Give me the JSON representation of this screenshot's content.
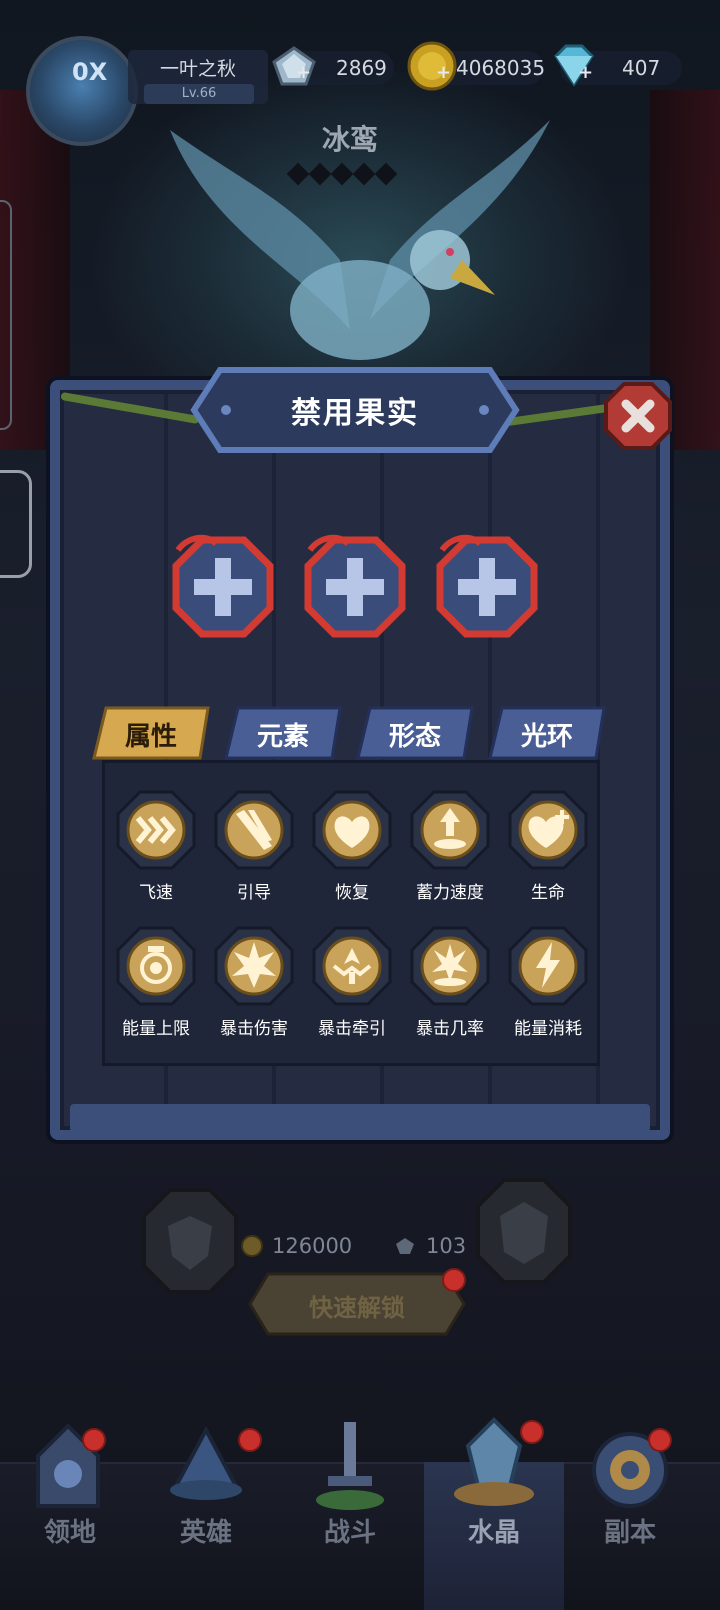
{
  "player": {
    "name": "一叶之秋",
    "level": "Lv.66",
    "avatar_mark": "0X"
  },
  "resources": {
    "crystal": "2869",
    "gold": "4068035",
    "gem": "407"
  },
  "hero": {
    "name": "冰鸾"
  },
  "dialog": {
    "title": "禁用果实"
  },
  "tabs": [
    {
      "label": "属性"
    },
    {
      "label": "元素"
    },
    {
      "label": "形态"
    },
    {
      "label": "光环"
    }
  ],
  "skills": [
    {
      "label": "飞速",
      "icon": "chevron-speed-icon"
    },
    {
      "label": "引导",
      "icon": "beam-icon"
    },
    {
      "label": "恢复",
      "icon": "heart-shield-icon"
    },
    {
      "label": "蓄力速度",
      "icon": "charge-up-icon"
    },
    {
      "label": "生命",
      "icon": "heart-plus-icon"
    },
    {
      "label": "能量上限",
      "icon": "energy-swirl-icon"
    },
    {
      "label": "暴击伤害",
      "icon": "burst-icon"
    },
    {
      "label": "暴击牵引",
      "icon": "crit-pull-icon"
    },
    {
      "label": "暴击几率",
      "icon": "crit-chance-icon"
    },
    {
      "label": "能量消耗",
      "icon": "lightning-icon"
    }
  ],
  "unlock": {
    "gold_cost": "126000",
    "crystal_cost": "103",
    "button_label": "快速解锁"
  },
  "nav": [
    {
      "label": "领地"
    },
    {
      "label": "英雄"
    },
    {
      "label": "战斗"
    },
    {
      "label": "水晶"
    },
    {
      "label": "副本"
    }
  ],
  "colors": {
    "tab_active": "#d6a84f",
    "tab_inactive": "#4a5e96",
    "panel_border": "#3c4f7a",
    "slot_ring": "#d23a32",
    "badge": "#c9302c"
  }
}
